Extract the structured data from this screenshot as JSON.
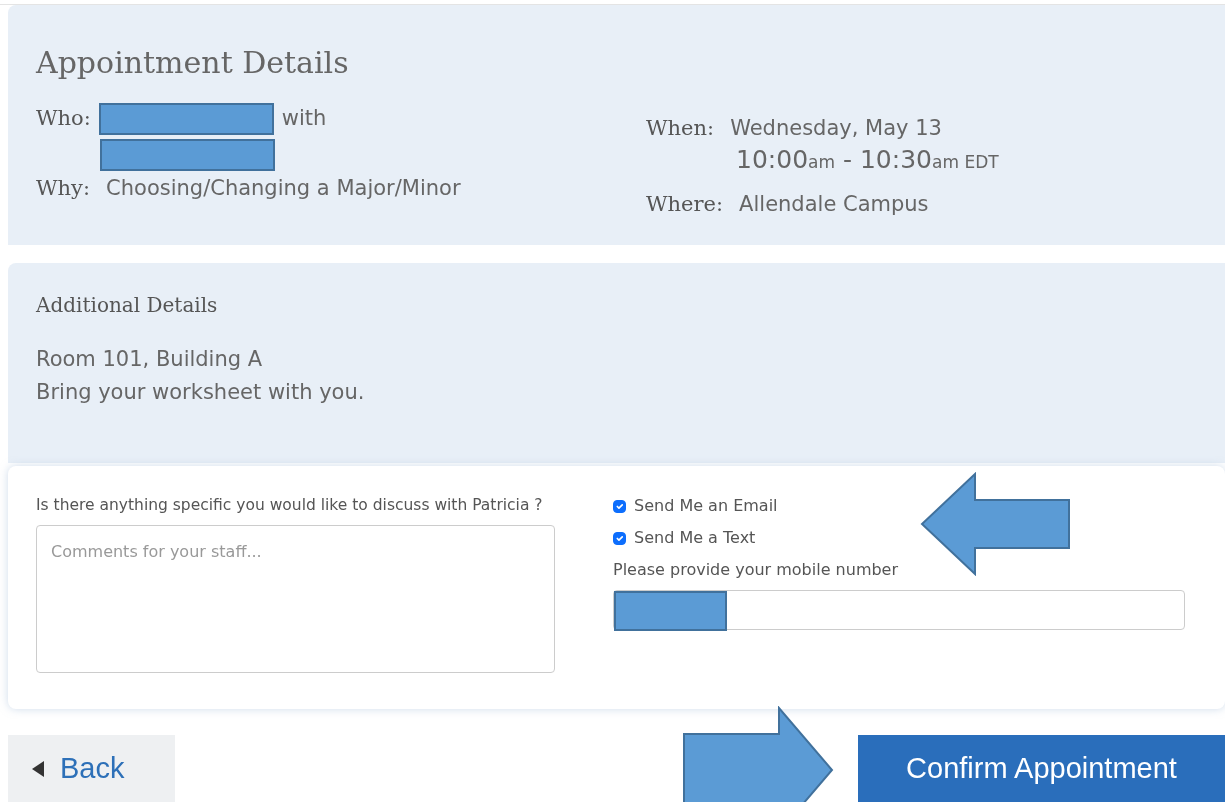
{
  "appointment": {
    "title": "Appointment Details",
    "who_label": "Who:",
    "who_connector": "with",
    "why_label": "Why:",
    "why_value": "Choosing/Changing a Major/Minor",
    "when_label": "When:",
    "when_date": "Wednesday, May 13",
    "when_time": {
      "start": "10:00",
      "start_period": "am",
      "separator": "-",
      "end": "10:30",
      "end_period": "am",
      "zone": "EDT"
    },
    "where_label": "Where:",
    "where_value": "Allendale Campus"
  },
  "additional": {
    "title": "Additional Details",
    "lines": [
      "Room 101, Building A",
      "Bring your worksheet with you."
    ]
  },
  "form": {
    "question": "Is there anything specific you would like to discuss with Patricia ?",
    "comment_placeholder": "Comments for your staff...",
    "notifications": [
      {
        "label": "Send Me an Email",
        "checked": true
      },
      {
        "label": "Send Me a Text",
        "checked": true
      }
    ],
    "mobile_label": "Please provide your mobile number"
  },
  "buttons": {
    "back": "Back",
    "confirm": "Confirm Appointment"
  }
}
